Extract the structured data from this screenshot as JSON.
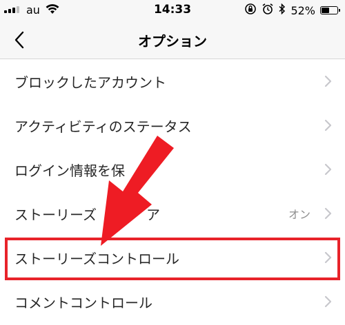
{
  "status_bar": {
    "carrier": "au",
    "time": "14:33",
    "battery_percent": "52%",
    "battery_level": 0.52
  },
  "header": {
    "title": "オプション",
    "back_icon": "chevron-left-icon"
  },
  "settings": {
    "items": [
      {
        "label": "ブロックしたアカウント",
        "value": ""
      },
      {
        "label": "アクティビティのステータス",
        "value": ""
      },
      {
        "label": "ログイン情報を保",
        "value": ""
      },
      {
        "label": "ストーリーズ",
        "label_tail": "ア",
        "value": "オン"
      },
      {
        "label": "ストーリーズコントロール",
        "value": ""
      },
      {
        "label": "コメントコントロール",
        "value": ""
      }
    ]
  },
  "annotation": {
    "arrow_color": "#ee1c24",
    "highlight_color": "#e8232a",
    "highlighted_item": "ストーリーズコントロール"
  }
}
